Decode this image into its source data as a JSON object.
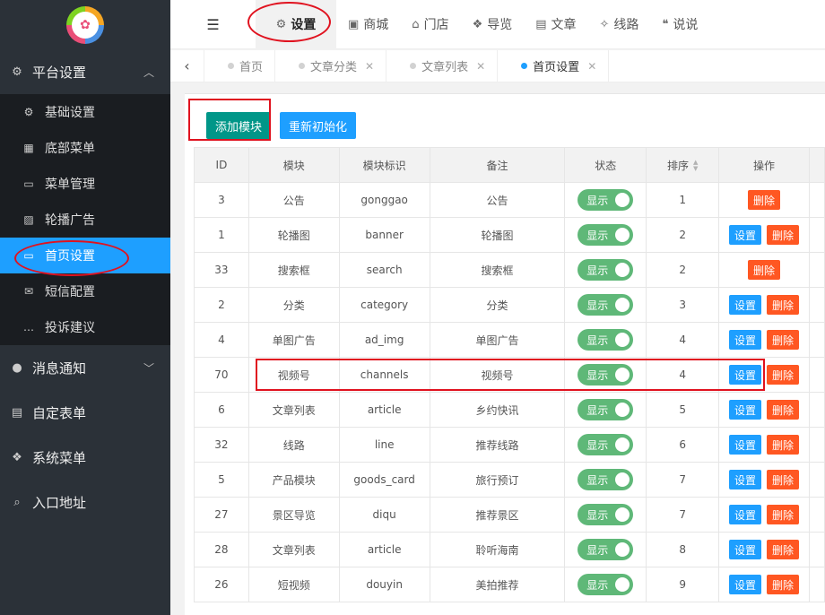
{
  "top_nav": {
    "items": [
      {
        "icon": "gears-icon",
        "glyph": "⚙",
        "label": "设置",
        "active": true
      },
      {
        "icon": "shop-icon",
        "glyph": "▣",
        "label": "商城",
        "active": false
      },
      {
        "icon": "bank-icon",
        "glyph": "⌂",
        "label": "门店",
        "active": false
      },
      {
        "icon": "cubes-icon",
        "glyph": "❖",
        "label": "导览",
        "active": false
      },
      {
        "icon": "newspaper-icon",
        "glyph": "▤",
        "label": "文章",
        "active": false
      },
      {
        "icon": "route-icon",
        "glyph": "✧",
        "label": "线路",
        "active": false
      },
      {
        "icon": "chat-icon",
        "glyph": "❝",
        "label": "说说",
        "active": false
      }
    ]
  },
  "tabs": [
    {
      "label": "首页",
      "closable": false,
      "active": false
    },
    {
      "label": "文章分类",
      "closable": true,
      "active": false
    },
    {
      "label": "文章列表",
      "closable": true,
      "active": false
    },
    {
      "label": "首页设置",
      "closable": true,
      "active": true
    }
  ],
  "sidebar": {
    "groups": [
      {
        "label": "平台设置",
        "icon": "gear-icon",
        "glyph": "⚙",
        "caret": "︿"
      },
      {
        "label": "消息通知",
        "icon": "comment-icon",
        "glyph": "●",
        "caret": "﹀"
      },
      {
        "label": "自定表单",
        "icon": "form-icon",
        "glyph": "▤"
      },
      {
        "label": "系统菜单",
        "icon": "cubes-icon",
        "glyph": "❖"
      },
      {
        "label": "入口地址",
        "icon": "search-icon",
        "glyph": "⌕"
      }
    ],
    "sub_items": [
      {
        "label": "基础设置",
        "icon": "gear-icon",
        "glyph": "⚙"
      },
      {
        "label": "底部菜单",
        "icon": "grid-icon",
        "glyph": "▦"
      },
      {
        "label": "菜单管理",
        "icon": "monitor-icon",
        "glyph": "▭"
      },
      {
        "label": "轮播广告",
        "icon": "image-icon",
        "glyph": "▨"
      },
      {
        "label": "首页设置",
        "icon": "monitor-icon",
        "glyph": "▭",
        "active": true
      },
      {
        "label": "短信配置",
        "icon": "envelope-icon",
        "glyph": "✉"
      },
      {
        "label": "投诉建议",
        "icon": "comment-dots-icon",
        "glyph": "…"
      }
    ]
  },
  "toolbar": {
    "add_label": "添加模块",
    "reinit_label": "重新初始化"
  },
  "table": {
    "columns": [
      "ID",
      "模块",
      "模块标识",
      "备注",
      "状态",
      "排序",
      "操作"
    ],
    "status_label": "显示",
    "set_label": "设置",
    "delete_label": "删除",
    "rows": [
      {
        "id": "3",
        "module": "公告",
        "key": "gonggao",
        "note": "公告",
        "sort": "1",
        "has_set": false
      },
      {
        "id": "1",
        "module": "轮播图",
        "key": "banner",
        "note": "轮播图",
        "sort": "2",
        "has_set": true
      },
      {
        "id": "33",
        "module": "搜索框",
        "key": "search",
        "note": "搜索框",
        "sort": "2",
        "has_set": false
      },
      {
        "id": "2",
        "module": "分类",
        "key": "category",
        "note": "分类",
        "sort": "3",
        "has_set": true
      },
      {
        "id": "4",
        "module": "单图广告",
        "key": "ad_img",
        "note": "单图广告",
        "sort": "4",
        "has_set": true
      },
      {
        "id": "70",
        "module": "视频号",
        "key": "channels",
        "note": "视频号",
        "sort": "4",
        "has_set": true
      },
      {
        "id": "6",
        "module": "文章列表",
        "key": "article",
        "note": "乡约快讯",
        "sort": "5",
        "has_set": true
      },
      {
        "id": "32",
        "module": "线路",
        "key": "line",
        "note": "推荐线路",
        "sort": "6",
        "has_set": true
      },
      {
        "id": "5",
        "module": "产品模块",
        "key": "goods_card",
        "note": "旅行预订",
        "sort": "7",
        "has_set": true
      },
      {
        "id": "27",
        "module": "景区导览",
        "key": "diqu",
        "note": "推荐景区",
        "sort": "7",
        "has_set": true
      },
      {
        "id": "28",
        "module": "文章列表",
        "key": "article",
        "note": "聆听海南",
        "sort": "8",
        "has_set": true
      },
      {
        "id": "26",
        "module": "短视频",
        "key": "douyin",
        "note": "美拍推荐",
        "sort": "9",
        "has_set": true
      }
    ]
  }
}
